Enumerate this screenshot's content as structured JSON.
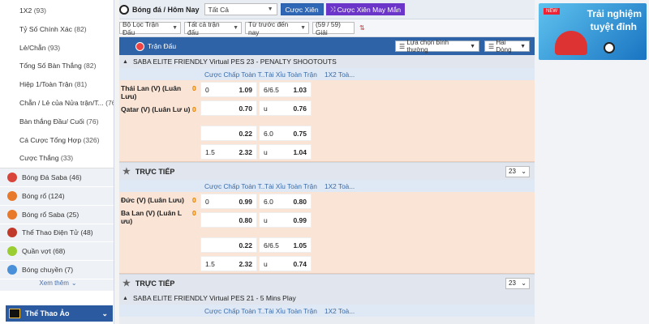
{
  "sidebar": {
    "sub_items": [
      {
        "label": "1X2",
        "count": "(93)"
      },
      {
        "label": "Tỷ Số Chính Xác",
        "count": "(82)"
      },
      {
        "label": "Lẻ/Chẵn",
        "count": "(93)"
      },
      {
        "label": "Tổng Số Bàn Thắng",
        "count": "(82)"
      },
      {
        "label": "Hiệp 1/Toàn Trận",
        "count": "(81)"
      },
      {
        "label": "Chẵn / Lẻ của Nửa trận/T...",
        "count": "(76)"
      },
      {
        "label": "Bàn thắng Đầu/ Cuối",
        "count": "(76)"
      },
      {
        "label": "Cá Cược Tổng Hợp",
        "count": "(326)"
      },
      {
        "label": "Cược Thắng",
        "count": "(33)"
      }
    ],
    "sports": [
      {
        "label": "Bóng Đá Saba",
        "count": "(46)",
        "color": "#d9443a"
      },
      {
        "label": "Bóng rổ",
        "count": "(124)",
        "color": "#e8782a"
      },
      {
        "label": "Bóng rổ Saba",
        "count": "(25)",
        "color": "#e8782a"
      },
      {
        "label": "Thể Thao Điện Tử",
        "count": "(48)",
        "color": "#c0392b"
      },
      {
        "label": "Quần vợt",
        "count": "(68)",
        "color": "#9acd32"
      },
      {
        "label": "Bóng chuyền",
        "count": "(7)",
        "color": "#4a90d9"
      }
    ],
    "see_more": "Xem thêm",
    "virtual": "Thể Thao Ảo"
  },
  "top": {
    "breadcrumb": "Bóng đá / Hôm Nay",
    "select": "Tất Cả",
    "btn_parlay": "Cược Xiên",
    "btn_lucky": "Cược Xiên May Mắn"
  },
  "filters": {
    "f1": "Bộ Lọc Trận Đấu",
    "f2": "Tất cả trận đấu",
    "f3": "Từ trước đến nay",
    "count": "(59 / 59) Giải"
  },
  "header": {
    "title": "Trận Đấu",
    "sel1": "Lựa chọn bình thường",
    "sel2": "Hai Dòng"
  },
  "columns": [
    "Cược Chấp Toàn T...",
    "Tài Xỉu Toàn Trận",
    "1X2 Toà..."
  ],
  "leagues": [
    {
      "name": "SABA ELITE FRIENDLY Virtual PES 23 - PENALTY SHOOTOUTS"
    },
    {
      "name": "SABA ELITE FRIENDLY Virtual PES 21 - 5 Mins Play"
    }
  ],
  "live_label": "TRỰC TIẾP",
  "live_page": "23",
  "matches": [
    {
      "home": "Thái Lan (V) (Luân Lưu)",
      "away": "Qatar (V) (Luân Lư u)",
      "home_score": "0",
      "away_score": "0",
      "rows": [
        [
          "0",
          "1.09",
          "6/6.5",
          "1.03"
        ],
        [
          "",
          "0.70",
          "u",
          "0.76"
        ],
        [
          "",
          "0.22",
          "6.0",
          "0.75"
        ],
        [
          "1.5",
          "2.32",
          "u",
          "1.04"
        ]
      ]
    },
    {
      "home": "Đức (V) (Luân Lưu)",
      "away": "Ba Lan (V) (Luân L ưu)",
      "home_score": "0",
      "away_score": "0",
      "rows": [
        [
          "0",
          "0.99",
          "6.0",
          "0.80"
        ],
        [
          "",
          "0.80",
          "u",
          "0.99"
        ],
        [
          "",
          "0.22",
          "6/6.5",
          "1.05"
        ],
        [
          "1.5",
          "2.32",
          "u",
          "0.74"
        ]
      ]
    }
  ],
  "banner": {
    "new": "NEW",
    "line1": "Trải nghiệm",
    "line2": "tuyệt đỉnh"
  }
}
